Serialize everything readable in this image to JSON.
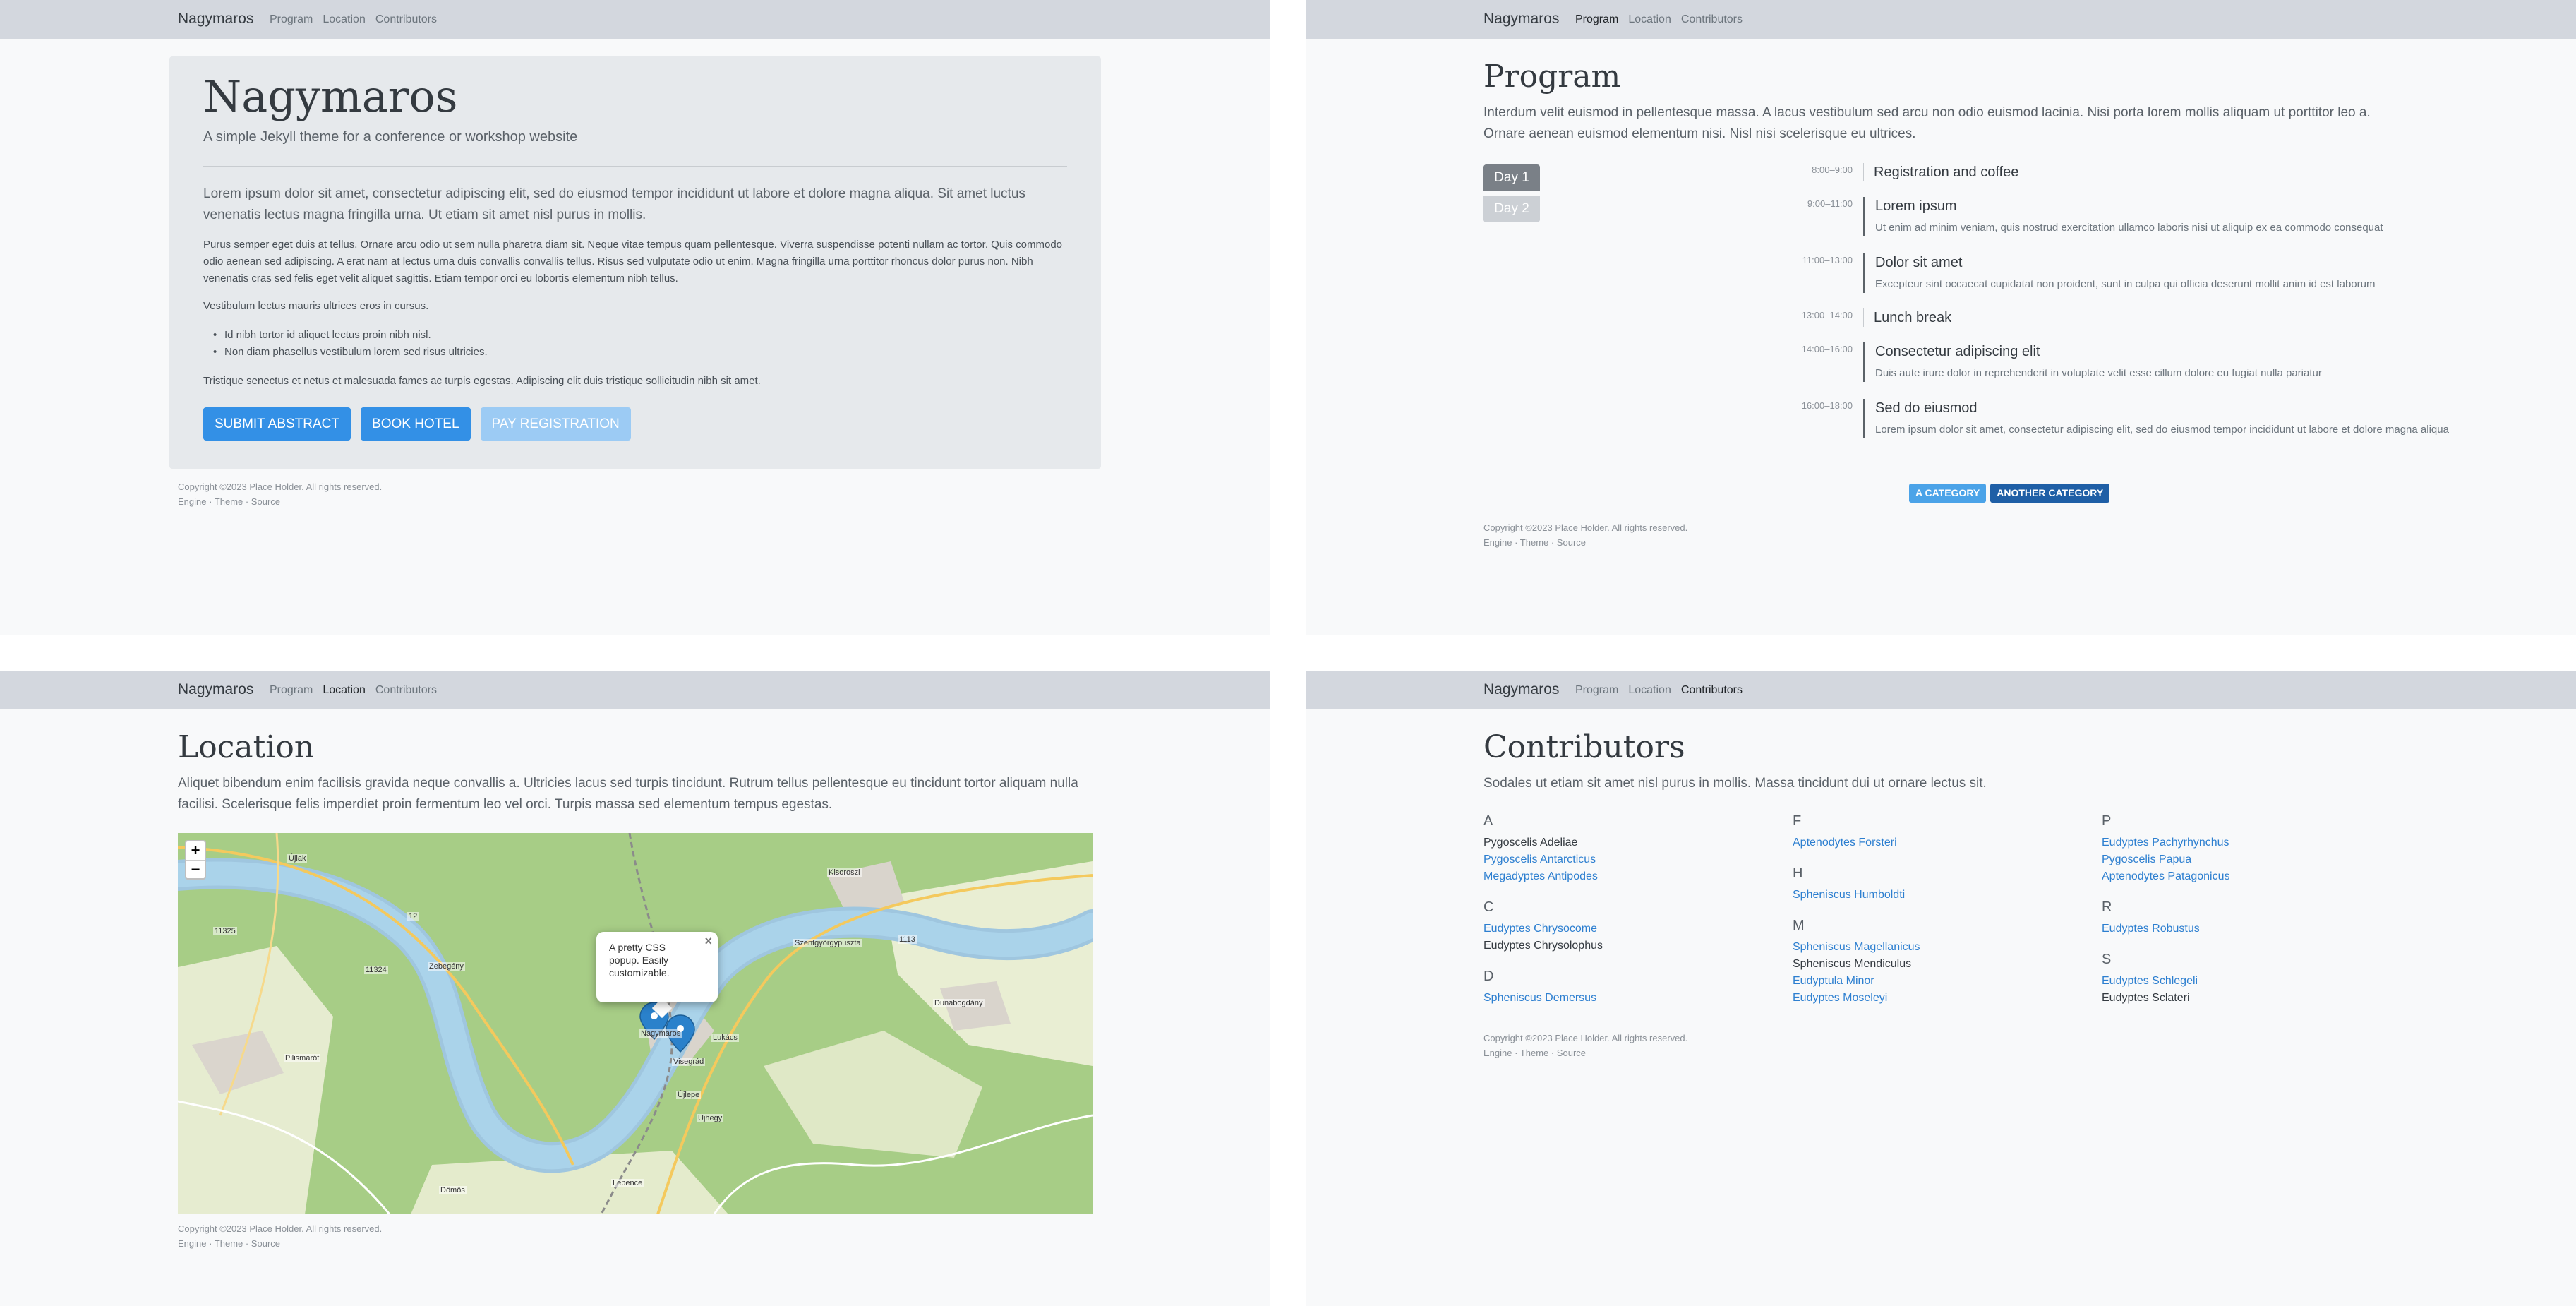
{
  "site": {
    "brand": "Nagymaros",
    "nav": [
      "Program",
      "Location",
      "Contributors"
    ],
    "footer": {
      "copyright": "Copyright ©2023 Place Holder. All rights reserved.",
      "links": "Engine · Theme · Source"
    }
  },
  "home": {
    "title": "Nagymaros",
    "subtitle": "A simple Jekyll theme for a conference or workshop website",
    "lead": "Lorem ipsum dolor sit amet, consectetur adipiscing elit, sed do eiusmod tempor incididunt ut labore et dolore magna aliqua. Sit amet luctus venenatis lectus magna fringilla urna. Ut etiam sit amet nisl purus in mollis.",
    "p2": "Purus semper eget duis at tellus. Ornare arcu odio ut sem nulla pharetra diam sit. Neque vitae tempus quam pellentesque. Viverra suspendisse potenti nullam ac tortor. Quis commodo odio aenean sed adipiscing. A erat nam at lectus urna duis convallis convallis tellus. Risus sed vulputate odio ut enim. Magna fringilla urna porttitor rhoncus dolor purus non. Nibh venenatis cras sed felis eget velit aliquet sagittis. Etiam tempor orci eu lobortis elementum nibh tellus.",
    "p3": "Vestibulum lectus mauris ultrices eros in cursus.",
    "list": [
      "Id nibh tortor id aliquet lectus proin nibh nisl.",
      "Non diam phasellus vestibulum lorem sed risus ultricies."
    ],
    "p4": "Tristique senectus et netus et malesuada fames ac turpis egestas. Adipiscing elit duis tristique sollicitudin nibh sit amet.",
    "buttons": [
      "Submit abstract",
      "Book hotel",
      "Pay registration"
    ]
  },
  "program": {
    "title": "Program",
    "intro": "Interdum velit euismod in pellentesque massa. A lacus vestibulum sed arcu non odio euismod lacinia. Nisi porta lorem mollis aliquam ut porttitor leo a. Ornare aenean euismod elementum nisi. Nisl nisi scelerisque eu ultrices.",
    "days": [
      "Day 1",
      "Day 2"
    ],
    "schedule": [
      {
        "time": "8:00–9:00",
        "title": "Registration and coffee",
        "desc": ""
      },
      {
        "time": "9:00–11:00",
        "title": "Lorem ipsum",
        "desc": "Ut enim ad minim veniam, quis nostrud exercitation ullamco laboris nisi ut aliquip ex ea commodo consequat"
      },
      {
        "time": "11:00–13:00",
        "title": "Dolor sit amet",
        "desc": "Excepteur sint occaecat cupidatat non proident, sunt in culpa qui officia deserunt mollit anim id est laborum"
      },
      {
        "time": "13:00–14:00",
        "title": "Lunch break",
        "desc": ""
      },
      {
        "time": "14:00–16:00",
        "title": "Consectetur adipiscing elit",
        "desc": "Duis aute irure dolor in reprehenderit in voluptate velit esse cillum dolore eu fugiat nulla pariatur"
      },
      {
        "time": "16:00–18:00",
        "title": "Sed do eiusmod",
        "desc": "Lorem ipsum dolor sit amet, consectetur adipiscing elit, sed do eiusmod tempor incididunt ut labore et dolore magna aliqua"
      }
    ],
    "categories": [
      {
        "label": "A category",
        "color": "#4ba3e8"
      },
      {
        "label": "Another category",
        "color": "#1f5fa6"
      }
    ]
  },
  "location": {
    "title": "Location",
    "intro": "Aliquet bibendum enim facilisis gravida neque convallis a. Ultricies lacus sed turpis tincidunt. Rutrum tellus pellentesque eu tincidunt tortor aliquam nulla facilisi. Scelerisque felis imperdiet proin fermentum leo vel orci. Turpis massa sed elementum tempus egestas.",
    "zoom_in": "+",
    "zoom_out": "−",
    "popup": "A pretty CSS popup. Easily customizable.",
    "popup_close": "×",
    "places": [
      "Nagymaros",
      "Visegrád",
      "Zebegény",
      "Szentgyörgypuszta",
      "Kisoroszi",
      "Dömös",
      "Dunabogdány",
      "Pilismarót",
      "Lepence",
      "Újlak",
      "Lukács",
      "Ujhegy",
      "Újlepe"
    ],
    "roads": [
      "11325",
      "11324",
      "1113",
      "12"
    ]
  },
  "contributors": {
    "title": "Contributors",
    "intro": "Sodales ut etiam sit amet nisl purus in mollis. Massa tincidunt dui ut ornare lectus sit.",
    "columns": [
      [
        {
          "letter": "A",
          "names": [
            {
              "n": "Pygoscelis Adeliae",
              "link": false
            },
            {
              "n": "Pygoscelis Antarcticus",
              "link": true
            },
            {
              "n": "Megadyptes Antipodes",
              "link": true
            }
          ]
        },
        {
          "letter": "C",
          "names": [
            {
              "n": "Eudyptes Chrysocome",
              "link": true
            },
            {
              "n": "Eudyptes Chrysolophus",
              "link": false
            }
          ]
        },
        {
          "letter": "D",
          "names": [
            {
              "n": "Spheniscus Demersus",
              "link": true
            }
          ]
        }
      ],
      [
        {
          "letter": "F",
          "names": [
            {
              "n": "Aptenodytes Forsteri",
              "link": true
            }
          ]
        },
        {
          "letter": "H",
          "names": [
            {
              "n": "Spheniscus Humboldti",
              "link": true
            }
          ]
        },
        {
          "letter": "M",
          "names": [
            {
              "n": "Spheniscus Magellanicus",
              "link": true
            },
            {
              "n": "Spheniscus Mendiculus",
              "link": false
            },
            {
              "n": "Eudyptula Minor",
              "link": true
            },
            {
              "n": "Eudyptes Moseleyi",
              "link": true
            }
          ]
        }
      ],
      [
        {
          "letter": "P",
          "names": [
            {
              "n": "Eudyptes Pachyrhynchus",
              "link": true
            },
            {
              "n": "Pygoscelis Papua",
              "link": true
            },
            {
              "n": "Aptenodytes Patagonicus",
              "link": true
            }
          ]
        },
        {
          "letter": "R",
          "names": [
            {
              "n": "Eudyptes Robustus",
              "link": true
            }
          ]
        },
        {
          "letter": "S",
          "names": [
            {
              "n": "Eudyptes Schlegeli",
              "link": true
            },
            {
              "n": "Eudyptes Sclateri",
              "link": false
            }
          ]
        }
      ]
    ]
  }
}
